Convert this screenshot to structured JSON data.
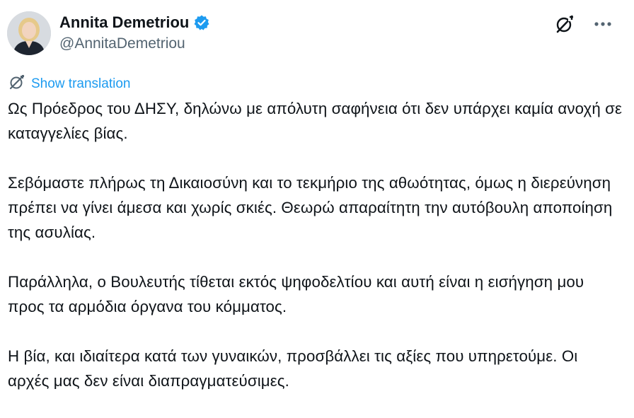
{
  "author": {
    "display_name": "Annita Demetriou",
    "handle": "@AnnitaDemetriou",
    "verified": true,
    "avatar_icon": "profile-photo"
  },
  "actions": {
    "grok_icon": "grok-icon",
    "more_icon": "more-dots-icon"
  },
  "translation": {
    "icon": "translate-icon",
    "label": "Show translation"
  },
  "body": {
    "paragraphs": [
      "Ως Πρόεδρος του ΔΗΣΥ, δηλώνω με απόλυτη σαφήνεια ότι δεν υπάρχει καμία ανοχή σε καταγγελίες βίας.",
      "Σεβόμαστε πλήρως τη Δικαιοσύνη και το τεκμήριο της αθωότητας, όμως η διερεύνηση πρέπει να γίνει άμεσα και χωρίς σκιές. Θεωρώ απαραίτητη την αυτόβουλη αποποίηση της ασυλίας.",
      "Παράλληλα, ο Βουλευτής τίθεται εκτός ψηφοδελτίου και αυτή είναι η εισήγηση μου προς τα αρμόδια όργανα του κόμματος.",
      "Η βία, και ιδιαίτερα κατά των γυναικών, προσβάλλει τις αξίες που υπηρετούμε. Οι αρχές μας δεν είναι διαπραγματεύσιμες."
    ]
  },
  "colors": {
    "text": "#0f1419",
    "secondary": "#536471",
    "accent": "#1d9bf0"
  }
}
